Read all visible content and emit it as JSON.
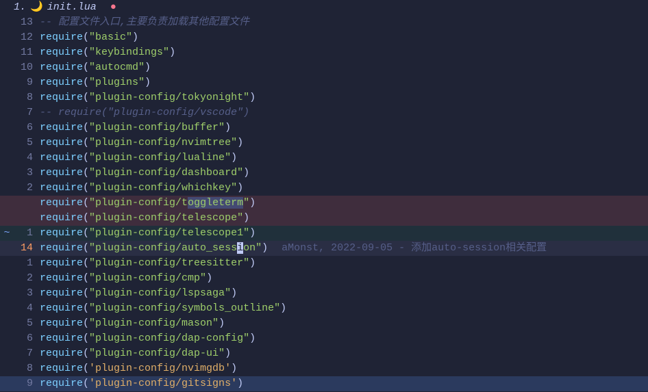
{
  "tab": {
    "index": "1.",
    "icon": "🌙",
    "filename": "init.lua",
    "modified": "●"
  },
  "blame": "aMonst, 2022-09-05 - 添加auto-session相关配置",
  "cursor_absolute_line": "14",
  "lines": [
    {
      "num": "13",
      "type": "comment",
      "text": "-- 配置文件入口,主要负责加载其他配置文件"
    },
    {
      "num": "12",
      "type": "require",
      "arg": "basic"
    },
    {
      "num": "11",
      "type": "require",
      "arg": "keybindings"
    },
    {
      "num": "10",
      "type": "require",
      "arg": "autocmd"
    },
    {
      "num": "9",
      "type": "require",
      "arg": "plugins"
    },
    {
      "num": "8",
      "type": "require",
      "arg": "plugin-config/tokyonight"
    },
    {
      "num": "7",
      "type": "comment",
      "text": "-- require(\"plugin-config/vscode\")"
    },
    {
      "num": "6",
      "type": "require",
      "arg": "plugin-config/buffer"
    },
    {
      "num": "5",
      "type": "require",
      "arg": "plugin-config/nvimtree"
    },
    {
      "num": "4",
      "type": "require",
      "arg": "plugin-config/lualine"
    },
    {
      "num": "3",
      "type": "require",
      "arg": "plugin-config/dashboard"
    },
    {
      "num": "2",
      "type": "require",
      "arg": "plugin-config/whichkey"
    },
    {
      "num": "",
      "type": "require",
      "arg_pre": "plugin-config/t",
      "arg_hl": "oggleterm",
      "diff": "del"
    },
    {
      "num": "",
      "type": "require",
      "arg": "plugin-config/telescope",
      "diff": "del"
    },
    {
      "num": "1",
      "type": "require",
      "arg": "plugin-config/telescope1",
      "diff": "add",
      "sign": "~"
    },
    {
      "num": "14",
      "type": "require_cursor",
      "arg_pre": "plugin-config/auto_sess",
      "cursor_ch": "i",
      "arg_post": "on",
      "current": true,
      "blame": true
    },
    {
      "num": "1",
      "type": "require",
      "arg": "plugin-config/treesitter"
    },
    {
      "num": "2",
      "type": "require",
      "arg": "plugin-config/cmp"
    },
    {
      "num": "3",
      "type": "require",
      "arg": "plugin-config/lspsaga"
    },
    {
      "num": "4",
      "type": "require",
      "arg": "plugin-config/symbols_outline"
    },
    {
      "num": "5",
      "type": "require",
      "arg": "plugin-config/mason"
    },
    {
      "num": "6",
      "type": "require",
      "arg": "plugin-config/dap-config"
    },
    {
      "num": "7",
      "type": "require",
      "arg": "plugin-config/dap-ui"
    },
    {
      "num": "8",
      "type": "require_single",
      "arg": "plugin-config/nvimgdb"
    },
    {
      "num": "9",
      "type": "require_single",
      "arg": "plugin-config/gitsigns",
      "diff": "change"
    }
  ]
}
